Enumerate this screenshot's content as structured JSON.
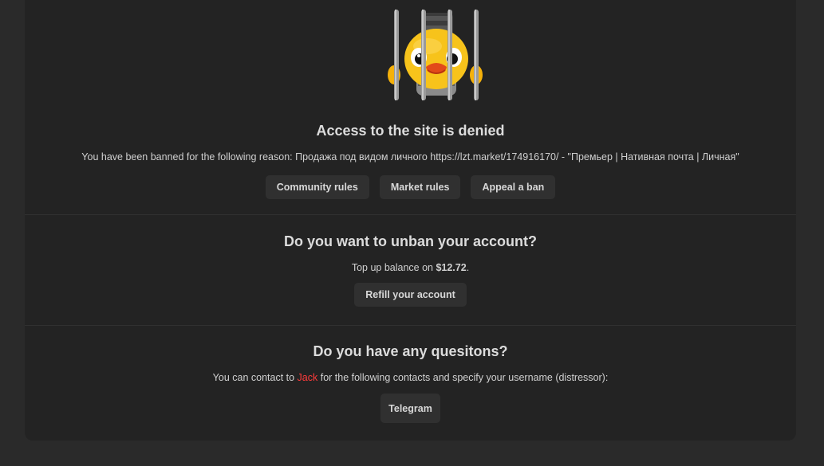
{
  "denied": {
    "title": "Access to the site is denied",
    "reason_text": "You have been banned for the following reason: Продажа под видом личного https://lzt.market/174916170/ - \"Премьер | Нативная почта | Личная\"",
    "buttons": [
      "Community rules",
      "Market rules",
      "Appeal a ban"
    ]
  },
  "unban": {
    "title": "Do you want to unban your account?",
    "balance_prefix": "Top up balance on ",
    "balance_amount": "$12.72",
    "balance_suffix": ".",
    "refill_label": "Refill your account"
  },
  "questions": {
    "title": "Do you have any quesitons?",
    "contact_prefix": "You can contact to ",
    "contact_name": "Jack",
    "contact_suffix": " for the following contacts and specify your username (distressor):",
    "telegram_label": "Telegram"
  },
  "colors": {
    "accent": "#ff3b3b",
    "card": "#232323",
    "page": "#2a2a2a",
    "button": "#303030"
  },
  "icons": {
    "mascot": "jailed-duck-icon"
  }
}
